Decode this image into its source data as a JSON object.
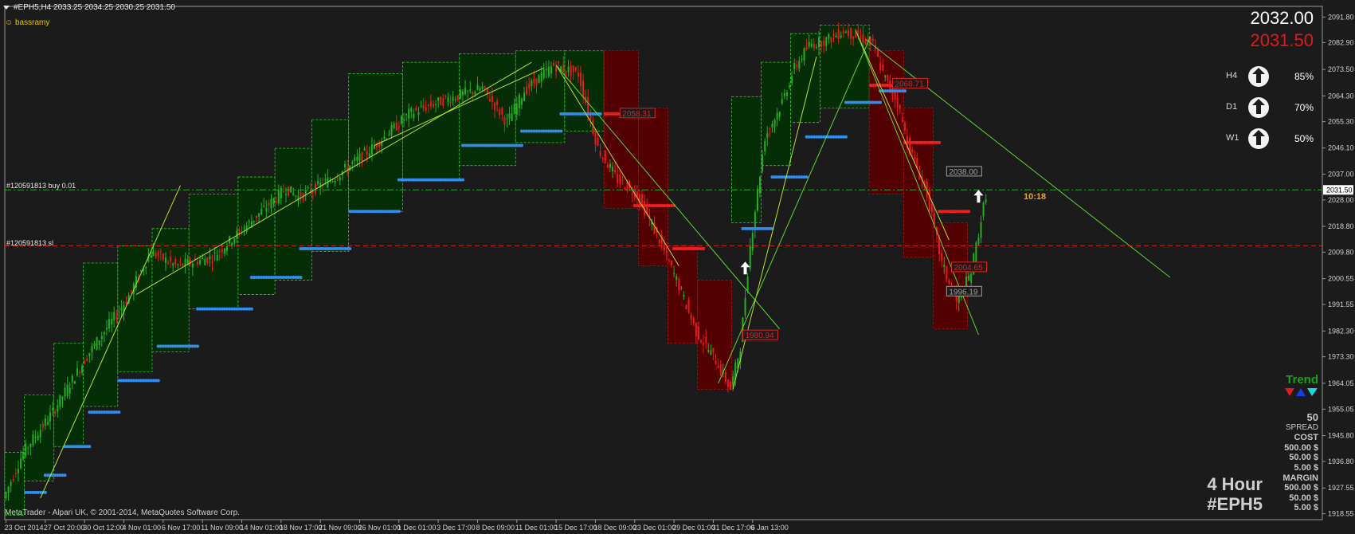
{
  "header": {
    "symbol_line": "#EPH5,H4  2033.25 2034.25 2030.25 2031.50",
    "indicator": "bassramy"
  },
  "prices": {
    "ask": "2032.00",
    "bid": "2031.50"
  },
  "timeframes": [
    {
      "tf": "H4",
      "pct": "85%",
      "icon": "up-arrow-icon"
    },
    {
      "tf": "D1",
      "pct": "70%",
      "icon": "up-arrow-icon"
    },
    {
      "tf": "W1",
      "pct": "50%",
      "icon": "up-arrow-icon"
    }
  ],
  "orders": [
    {
      "label": "#120591813 buy 0.01",
      "price": 2031.5,
      "color": "#22aa22"
    },
    {
      "label": "#120591813 sl",
      "price": 2012.0,
      "color": "#e02020"
    }
  ],
  "timer": "10:18",
  "trend_panel": {
    "title": "Trend",
    "colors": [
      "#e01b1b",
      "#1a3ee0",
      "#19d7e6"
    ]
  },
  "stats": [
    {
      "text": "50",
      "type": "value"
    },
    {
      "text": "SPREAD",
      "type": "label"
    },
    {
      "text": "COST",
      "type": "value"
    },
    {
      "text": "500.00 $",
      "type": "value"
    },
    {
      "text": "50.00 $",
      "type": "value"
    },
    {
      "text": "5.00 $",
      "type": "value"
    },
    {
      "text": "MARGIN",
      "type": "value"
    },
    {
      "text": "500.00 $",
      "type": "value"
    },
    {
      "text": "50.00 $",
      "type": "value"
    },
    {
      "text": "5.00 $",
      "type": "value"
    }
  ],
  "big_labels": [
    "4 Hour",
    "#EPH5"
  ],
  "footer": "MetaTrader - Alpari UK, © 2001-2014, MetaQuotes Software Corp.",
  "chart_data": {
    "type": "candlestick",
    "symbol": "#EPH5",
    "timeframe": "H4",
    "current_price": 2031.5,
    "ylim": [
      1916.5,
      2095.5
    ],
    "y_ticks": [
      2091.8,
      2082.9,
      2073.5,
      2064.3,
      2055.3,
      2046.1,
      2037.0,
      2028.0,
      2018.8,
      2009.8,
      2000.55,
      1991.55,
      1982.3,
      1973.3,
      1964.05,
      1955.05,
      1945.8,
      1936.8,
      1927.55,
      1918.55
    ],
    "y_tick_labels": [
      "2091.80",
      "2082.90",
      "2073.50",
      "2064.30",
      "2055.30",
      "2046.10",
      "2037.00",
      "2028.00",
      "2018.80",
      "2009.80",
      "2000.55",
      "1991.55",
      "1982.30",
      "1973.30",
      "1964.05",
      "1955.05",
      "1945.80",
      "1936.80",
      "1927.55",
      "1918.55"
    ],
    "x_tick_labels": [
      "23 Oct 2014",
      "27 Oct 20:00",
      "30 Oct 12:00",
      "4 Nov 01:00",
      "6 Nov 17:00",
      "11 Nov 09:00",
      "14 Nov 01:00",
      "18 Nov 17:00",
      "21 Nov 09:00",
      "26 Nov 01:00",
      "1 Dec 01:00",
      "3 Dec 17:00",
      "8 Dec 09:00",
      "11 Dec 01:00",
      "15 Dec 17:00",
      "18 Dec 09:00",
      "23 Dec 01:00",
      "29 Dec 01:00",
      "31 Dec 17:00",
      "6 Jan 13:00"
    ],
    "bars_per_tick": 16,
    "total_bars": 313,
    "path_anchors": [
      [
        0,
        1924
      ],
      [
        8,
        1940
      ],
      [
        20,
        1954
      ],
      [
        35,
        1975
      ],
      [
        50,
        1993
      ],
      [
        60,
        2010
      ],
      [
        70,
        2005
      ],
      [
        85,
        2008
      ],
      [
        100,
        2020
      ],
      [
        115,
        2032
      ],
      [
        120,
        2029
      ],
      [
        135,
        2036
      ],
      [
        150,
        2046
      ],
      [
        165,
        2058
      ],
      [
        180,
        2063
      ],
      [
        195,
        2067
      ],
      [
        205,
        2055
      ],
      [
        212,
        2066
      ],
      [
        224,
        2075
      ],
      [
        234,
        2072
      ],
      [
        242,
        2046
      ],
      [
        250,
        2035
      ],
      [
        258,
        2030
      ],
      [
        268,
        2012
      ],
      [
        275,
        1998
      ],
      [
        282,
        1982
      ],
      [
        290,
        1972
      ],
      [
        296,
        1962
      ],
      [
        300,
        1977
      ],
      [
        304,
        2012
      ],
      [
        310,
        2050
      ],
      [
        316,
        2060
      ],
      [
        322,
        2074
      ],
      [
        328,
        2082
      ],
      [
        336,
        2084
      ],
      [
        342,
        2087
      ],
      [
        348,
        2085
      ],
      [
        354,
        2082
      ],
      [
        358,
        2072
      ],
      [
        364,
        2062
      ],
      [
        368,
        2048
      ],
      [
        376,
        2030
      ],
      [
        382,
        2006
      ],
      [
        388,
        1992
      ],
      [
        394,
        2003
      ],
      [
        400,
        2030
      ]
    ],
    "channel_segments": [
      {
        "from": 0,
        "to": 8,
        "top": 1940,
        "bottom": 1918
      },
      {
        "from": 8,
        "to": 20,
        "top": 1960,
        "bottom": 1930
      },
      {
        "from": 20,
        "to": 32,
        "top": 1978,
        "bottom": 1942
      },
      {
        "from": 32,
        "to": 46,
        "top": 2006,
        "bottom": 1956
      },
      {
        "from": 46,
        "to": 60,
        "top": 2012,
        "bottom": 1968
      },
      {
        "from": 60,
        "to": 75,
        "top": 2018,
        "bottom": 1975
      },
      {
        "from": 75,
        "to": 95,
        "top": 2030,
        "bottom": 1990
      },
      {
        "from": 95,
        "to": 110,
        "top": 2036,
        "bottom": 1995
      },
      {
        "from": 110,
        "to": 125,
        "top": 2046,
        "bottom": 2000
      },
      {
        "from": 125,
        "to": 140,
        "top": 2056,
        "bottom": 2010
      },
      {
        "from": 140,
        "to": 162,
        "top": 2072,
        "bottom": 2024
      },
      {
        "from": 162,
        "to": 185,
        "top": 2076,
        "bottom": 2035
      },
      {
        "from": 185,
        "to": 208,
        "top": 2079,
        "bottom": 2040
      },
      {
        "from": 208,
        "to": 228,
        "top": 2080,
        "bottom": 2048
      },
      {
        "from": 228,
        "to": 244,
        "top": 2080,
        "bottom": 2052
      },
      {
        "from": 296,
        "to": 308,
        "top": 2064,
        "bottom": 2020
      },
      {
        "from": 308,
        "to": 320,
        "top": 2076,
        "bottom": 2040
      },
      {
        "from": 320,
        "to": 332,
        "top": 2086,
        "bottom": 2055
      },
      {
        "from": 332,
        "to": 352,
        "top": 2089,
        "bottom": 2060
      }
    ],
    "bear_segments": [
      {
        "from": 244,
        "to": 258,
        "top": 2080,
        "bottom": 2025
      },
      {
        "from": 258,
        "to": 270,
        "top": 2060,
        "bottom": 2005
      },
      {
        "from": 270,
        "to": 282,
        "top": 2012,
        "bottom": 1978
      },
      {
        "from": 282,
        "to": 296,
        "top": 2000,
        "bottom": 1962
      },
      {
        "from": 352,
        "to": 366,
        "top": 2080,
        "bottom": 2030
      },
      {
        "from": 366,
        "to": 378,
        "top": 2060,
        "bottom": 2008
      },
      {
        "from": 378,
        "to": 392,
        "top": 2020,
        "bottom": 1983
      }
    ],
    "support_dots": [
      {
        "from": 8,
        "to": 16,
        "price": 1926
      },
      {
        "from": 16,
        "to": 24,
        "price": 1932
      },
      {
        "from": 24,
        "to": 34,
        "price": 1942
      },
      {
        "from": 34,
        "to": 46,
        "price": 1954
      },
      {
        "from": 46,
        "to": 62,
        "price": 1965
      },
      {
        "from": 62,
        "to": 78,
        "price": 1977
      },
      {
        "from": 78,
        "to": 100,
        "price": 1990
      },
      {
        "from": 100,
        "to": 120,
        "price": 2001
      },
      {
        "from": 120,
        "to": 140,
        "price": 2011
      },
      {
        "from": 140,
        "to": 160,
        "price": 2024
      },
      {
        "from": 160,
        "to": 186,
        "price": 2035
      },
      {
        "from": 186,
        "to": 210,
        "price": 2047
      },
      {
        "from": 210,
        "to": 226,
        "price": 2052
      },
      {
        "from": 226,
        "to": 242,
        "price": 2058
      },
      {
        "from": 300,
        "to": 312,
        "price": 2018
      },
      {
        "from": 312,
        "to": 326,
        "price": 2036
      },
      {
        "from": 326,
        "to": 342,
        "price": 2050
      },
      {
        "from": 342,
        "to": 356,
        "price": 2062
      },
      {
        "from": 356,
        "to": 366,
        "price": 2066
      }
    ],
    "resistance_dots": [
      {
        "from": 244,
        "to": 256,
        "price": 2058
      },
      {
        "from": 256,
        "to": 272,
        "price": 2026
      },
      {
        "from": 272,
        "to": 284,
        "price": 2011
      },
      {
        "from": 352,
        "to": 366,
        "price": 2068
      },
      {
        "from": 366,
        "to": 380,
        "price": 2048
      },
      {
        "from": 380,
        "to": 392,
        "price": 2024
      }
    ],
    "lines": [
      {
        "color": "#b5e32d",
        "points": [
          [
            14,
            1924
          ],
          [
            71,
            2033
          ]
        ]
      },
      {
        "color": "#b5e32d",
        "points": [
          [
            53,
            1995
          ],
          [
            214,
            2076
          ]
        ]
      },
      {
        "color": "#b5e32d",
        "points": [
          [
            150,
            2047
          ],
          [
            219,
            2074
          ]
        ]
      },
      {
        "color": "#b5e32d",
        "points": [
          [
            224,
            2075
          ],
          [
            274,
            2005
          ]
        ]
      },
      {
        "color": "#b5e32d",
        "points": [
          [
            296,
            1962
          ],
          [
            330,
            2078
          ]
        ]
      },
      {
        "color": "#b5e32d",
        "points": [
          [
            346,
            2087
          ],
          [
            384,
            2014
          ]
        ]
      },
      {
        "color": "#5ed82e",
        "points": [
          [
            224,
            2075
          ],
          [
            315,
            1983
          ]
        ]
      },
      {
        "color": "#5ed82e",
        "points": [
          [
            290,
            1964
          ],
          [
            352,
            2085
          ]
        ]
      },
      {
        "color": "#5ed82e",
        "points": [
          [
            346,
            2087
          ],
          [
            396,
            1981
          ]
        ]
      },
      {
        "color": "#5ed82e",
        "points": [
          [
            350,
            2084
          ],
          [
            474,
            2001
          ]
        ]
      }
    ],
    "price_boxes": [
      {
        "bar": 250,
        "price": 2058.31,
        "label": "2058.31",
        "color": "#e02020"
      },
      {
        "bar": 300,
        "price": 1980.94,
        "label": "1980.94",
        "color": "#e02020"
      },
      {
        "bar": 361,
        "price": 2068.71,
        "label": "2068.71",
        "color": "#e02020"
      },
      {
        "bar": 385,
        "price": 2004.65,
        "label": "2004.65",
        "color": "#e02020"
      },
      {
        "bar": 383,
        "price": 2038.0,
        "label": "2038.00",
        "color": "#a0a0a0"
      },
      {
        "bar": 383,
        "price": 1996.19,
        "label": "1996.19",
        "color": "#a0a0a0"
      }
    ],
    "up_arrows": [
      {
        "bar": 301,
        "price": 2004
      },
      {
        "bar": 396,
        "price": 2029
      }
    ],
    "grid": false
  }
}
